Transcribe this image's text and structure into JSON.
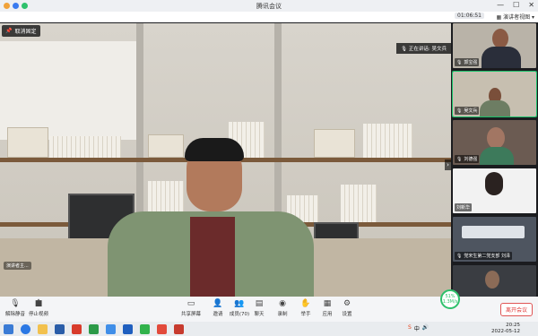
{
  "window": {
    "title": "腾讯会议",
    "minimize": "—",
    "maximize": "☐",
    "close": "✕"
  },
  "toolrow": {
    "timer": "01:06:51",
    "view_label": "演讲者视图"
  },
  "stage": {
    "unpin_label": "取消固定",
    "main_name": "演讲者主...",
    "talking_label": "正在讲话: 吴文兵"
  },
  "sidebar": {
    "tiles": [
      {
        "name": "郭宝强"
      },
      {
        "name": "吴文兵"
      },
      {
        "name": "刘德强"
      },
      {
        "name": "刘新华"
      },
      {
        "name": "党宋生第二党支部 刘泽"
      },
      {
        "name": ""
      }
    ]
  },
  "controls": {
    "mute": "解除静音",
    "video": "停止视频",
    "share": "共享屏幕",
    "invite": "邀请",
    "members": "成员(70)",
    "chat": "聊天",
    "record": "录制",
    "reactions": "举手",
    "apps": "应用",
    "settings": "设置",
    "end": "离开会议"
  },
  "network": {
    "percent": "51%",
    "speed": "1.3M/s"
  },
  "taskbar": {
    "time": "20:25",
    "date": "2022-05-12",
    "ime": "中"
  },
  "colors": {
    "accent_green": "#19c26b",
    "end_red": "#e03c3c"
  }
}
